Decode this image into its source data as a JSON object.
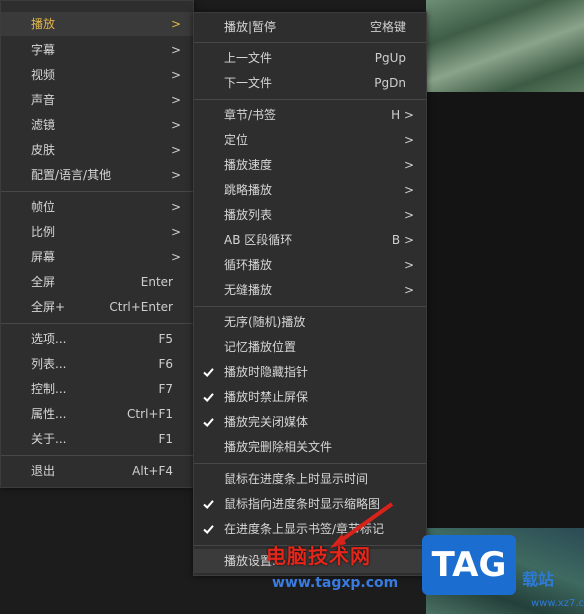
{
  "left_menu": {
    "items": [
      {
        "label": "播放",
        "arrow": ">"
      },
      {
        "label": "字幕",
        "arrow": ">"
      },
      {
        "label": "视频",
        "arrow": ">"
      },
      {
        "label": "声音",
        "arrow": ">"
      },
      {
        "label": "滤镜",
        "arrow": ">"
      },
      {
        "label": "皮肤",
        "arrow": ">"
      },
      {
        "label": "配置/语言/其他",
        "arrow": ">"
      },
      {
        "label": "帧位",
        "arrow": ">"
      },
      {
        "label": "比例",
        "arrow": ">"
      },
      {
        "label": "屏幕",
        "arrow": ">"
      },
      {
        "label": "全屏",
        "shortcut": "Enter"
      },
      {
        "label": "全屏+",
        "shortcut": "Ctrl+Enter"
      },
      {
        "label": "选项...",
        "shortcut": "F5"
      },
      {
        "label": "列表...",
        "shortcut": "F6"
      },
      {
        "label": "控制...",
        "shortcut": "F7"
      },
      {
        "label": "属性...",
        "shortcut": "Ctrl+F1"
      },
      {
        "label": "关于...",
        "shortcut": "F1"
      },
      {
        "label": "退出",
        "shortcut": "Alt+F4"
      }
    ]
  },
  "play_submenu": {
    "items": [
      {
        "label": "播放|暂停",
        "shortcut": "空格键"
      },
      {
        "label": "上一文件",
        "shortcut": "PgUp"
      },
      {
        "label": "下一文件",
        "shortcut": "PgDn"
      },
      {
        "label": "章节/书签",
        "shortcut": "H >"
      },
      {
        "label": "定位",
        "arrow": ">"
      },
      {
        "label": "播放速度",
        "arrow": ">"
      },
      {
        "label": "跳略播放",
        "arrow": ">"
      },
      {
        "label": "播放列表",
        "arrow": ">"
      },
      {
        "label": "AB 区段循环",
        "shortcut": "B >"
      },
      {
        "label": "循环播放",
        "arrow": ">"
      },
      {
        "label": "无缝播放",
        "arrow": ">"
      },
      {
        "label": "无序(随机)播放",
        "checked": false
      },
      {
        "label": "记忆播放位置",
        "checked": false
      },
      {
        "label": "播放时隐藏指针",
        "checked": true
      },
      {
        "label": "播放时禁止屏保",
        "checked": true
      },
      {
        "label": "播放完关闭媒体",
        "checked": true
      },
      {
        "label": "播放完删除相关文件",
        "checked": false
      },
      {
        "label": "鼠标在进度条上时显示时间",
        "checked": false
      },
      {
        "label": "鼠标指向进度条时显示缩略图",
        "checked": true
      },
      {
        "label": "在进度条上显示书签/章节标记",
        "checked": true
      },
      {
        "label": "播放设置..."
      }
    ]
  },
  "watermark": {
    "site_name": "电脑技术网",
    "url": "www.tagxp.com",
    "logo": "TAG",
    "side_text": "载站",
    "small_text": "www.xz7.com"
  },
  "colors": {
    "active": "#e0b64b",
    "menu_bg": "#2e2e2e",
    "check": "#ffffff"
  }
}
